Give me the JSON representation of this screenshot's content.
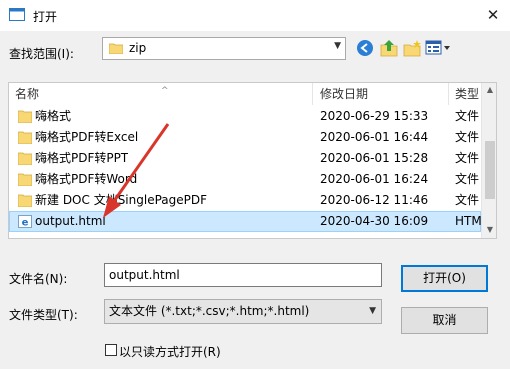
{
  "window": {
    "title": "打开",
    "close_glyph": "✕"
  },
  "look_in": {
    "label": "查找范围(I):",
    "value": "zip"
  },
  "columns": [
    {
      "label": "名称"
    },
    {
      "label": "修改日期"
    },
    {
      "label": "类型"
    }
  ],
  "rows": [
    {
      "name": "嗨格式",
      "date": "2020-06-29 15:33",
      "type": "文件",
      "icon": "folder-icon",
      "selected": false
    },
    {
      "name": "嗨格式PDF转Excel",
      "date": "2020-06-01 16:44",
      "type": "文件",
      "icon": "folder-icon",
      "selected": false
    },
    {
      "name": "嗨格式PDF转PPT",
      "date": "2020-06-01 15:28",
      "type": "文件",
      "icon": "folder-icon",
      "selected": false
    },
    {
      "name": "嗨格式PDF转Word",
      "date": "2020-06-01 16:24",
      "type": "文件",
      "icon": "folder-icon",
      "selected": false
    },
    {
      "name": "新建 DOC 文档SinglePagePDF",
      "date": "2020-06-12 11:46",
      "type": "文件",
      "icon": "folder-icon",
      "selected": false
    },
    {
      "name": "output.html",
      "date": "2020-04-30 16:09",
      "type": "HTM",
      "icon": "ie-html-file-icon",
      "selected": true
    }
  ],
  "filename": {
    "label": "文件名(N):",
    "value": "output.html"
  },
  "filetype": {
    "label": "文件类型(T):",
    "value": "文本文件 (*.txt;*.csv;*.htm;*.html)"
  },
  "buttons": {
    "open": "打开(O)",
    "cancel": "取消"
  },
  "readonly": {
    "label": "以只读方式打开(R)",
    "checked": false
  },
  "colors": {
    "selection": "#cce8ff",
    "accent": "#0078d7",
    "folder": "#f8d775",
    "arrow": "#d9352b"
  }
}
